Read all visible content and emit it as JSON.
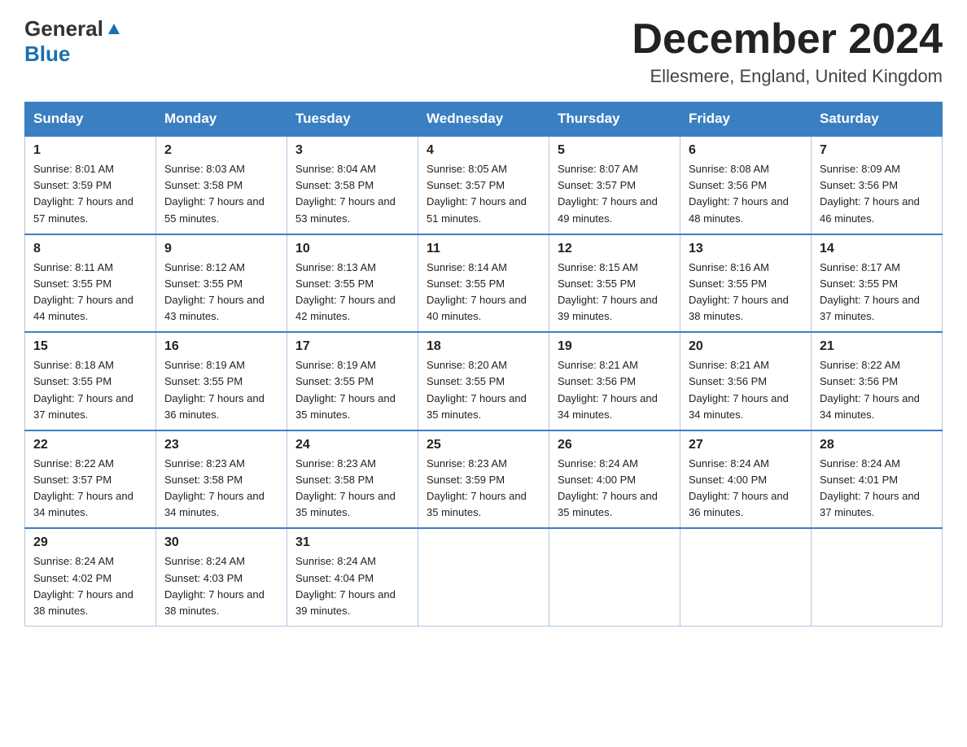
{
  "header": {
    "logo_general": "General",
    "logo_blue": "Blue",
    "title": "December 2024",
    "subtitle": "Ellesmere, England, United Kingdom"
  },
  "days_of_week": [
    "Sunday",
    "Monday",
    "Tuesday",
    "Wednesday",
    "Thursday",
    "Friday",
    "Saturday"
  ],
  "weeks": [
    [
      {
        "day": "1",
        "sunrise": "8:01 AM",
        "sunset": "3:59 PM",
        "daylight": "7 hours and 57 minutes."
      },
      {
        "day": "2",
        "sunrise": "8:03 AM",
        "sunset": "3:58 PM",
        "daylight": "7 hours and 55 minutes."
      },
      {
        "day": "3",
        "sunrise": "8:04 AM",
        "sunset": "3:58 PM",
        "daylight": "7 hours and 53 minutes."
      },
      {
        "day": "4",
        "sunrise": "8:05 AM",
        "sunset": "3:57 PM",
        "daylight": "7 hours and 51 minutes."
      },
      {
        "day": "5",
        "sunrise": "8:07 AM",
        "sunset": "3:57 PM",
        "daylight": "7 hours and 49 minutes."
      },
      {
        "day": "6",
        "sunrise": "8:08 AM",
        "sunset": "3:56 PM",
        "daylight": "7 hours and 48 minutes."
      },
      {
        "day": "7",
        "sunrise": "8:09 AM",
        "sunset": "3:56 PM",
        "daylight": "7 hours and 46 minutes."
      }
    ],
    [
      {
        "day": "8",
        "sunrise": "8:11 AM",
        "sunset": "3:55 PM",
        "daylight": "7 hours and 44 minutes."
      },
      {
        "day": "9",
        "sunrise": "8:12 AM",
        "sunset": "3:55 PM",
        "daylight": "7 hours and 43 minutes."
      },
      {
        "day": "10",
        "sunrise": "8:13 AM",
        "sunset": "3:55 PM",
        "daylight": "7 hours and 42 minutes."
      },
      {
        "day": "11",
        "sunrise": "8:14 AM",
        "sunset": "3:55 PM",
        "daylight": "7 hours and 40 minutes."
      },
      {
        "day": "12",
        "sunrise": "8:15 AM",
        "sunset": "3:55 PM",
        "daylight": "7 hours and 39 minutes."
      },
      {
        "day": "13",
        "sunrise": "8:16 AM",
        "sunset": "3:55 PM",
        "daylight": "7 hours and 38 minutes."
      },
      {
        "day": "14",
        "sunrise": "8:17 AM",
        "sunset": "3:55 PM",
        "daylight": "7 hours and 37 minutes."
      }
    ],
    [
      {
        "day": "15",
        "sunrise": "8:18 AM",
        "sunset": "3:55 PM",
        "daylight": "7 hours and 37 minutes."
      },
      {
        "day": "16",
        "sunrise": "8:19 AM",
        "sunset": "3:55 PM",
        "daylight": "7 hours and 36 minutes."
      },
      {
        "day": "17",
        "sunrise": "8:19 AM",
        "sunset": "3:55 PM",
        "daylight": "7 hours and 35 minutes."
      },
      {
        "day": "18",
        "sunrise": "8:20 AM",
        "sunset": "3:55 PM",
        "daylight": "7 hours and 35 minutes."
      },
      {
        "day": "19",
        "sunrise": "8:21 AM",
        "sunset": "3:56 PM",
        "daylight": "7 hours and 34 minutes."
      },
      {
        "day": "20",
        "sunrise": "8:21 AM",
        "sunset": "3:56 PM",
        "daylight": "7 hours and 34 minutes."
      },
      {
        "day": "21",
        "sunrise": "8:22 AM",
        "sunset": "3:56 PM",
        "daylight": "7 hours and 34 minutes."
      }
    ],
    [
      {
        "day": "22",
        "sunrise": "8:22 AM",
        "sunset": "3:57 PM",
        "daylight": "7 hours and 34 minutes."
      },
      {
        "day": "23",
        "sunrise": "8:23 AM",
        "sunset": "3:58 PM",
        "daylight": "7 hours and 34 minutes."
      },
      {
        "day": "24",
        "sunrise": "8:23 AM",
        "sunset": "3:58 PM",
        "daylight": "7 hours and 35 minutes."
      },
      {
        "day": "25",
        "sunrise": "8:23 AM",
        "sunset": "3:59 PM",
        "daylight": "7 hours and 35 minutes."
      },
      {
        "day": "26",
        "sunrise": "8:24 AM",
        "sunset": "4:00 PM",
        "daylight": "7 hours and 35 minutes."
      },
      {
        "day": "27",
        "sunrise": "8:24 AM",
        "sunset": "4:00 PM",
        "daylight": "7 hours and 36 minutes."
      },
      {
        "day": "28",
        "sunrise": "8:24 AM",
        "sunset": "4:01 PM",
        "daylight": "7 hours and 37 minutes."
      }
    ],
    [
      {
        "day": "29",
        "sunrise": "8:24 AM",
        "sunset": "4:02 PM",
        "daylight": "7 hours and 38 minutes."
      },
      {
        "day": "30",
        "sunrise": "8:24 AM",
        "sunset": "4:03 PM",
        "daylight": "7 hours and 38 minutes."
      },
      {
        "day": "31",
        "sunrise": "8:24 AM",
        "sunset": "4:04 PM",
        "daylight": "7 hours and 39 minutes."
      },
      null,
      null,
      null,
      null
    ]
  ]
}
